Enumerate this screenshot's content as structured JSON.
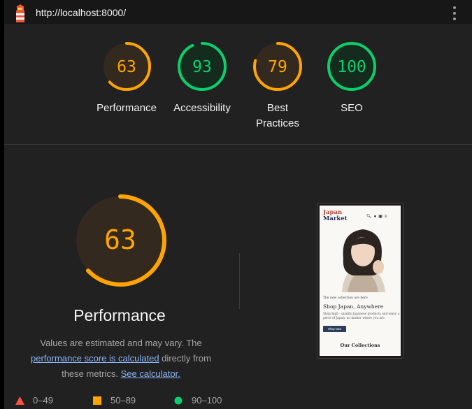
{
  "topbar": {
    "url": "http://localhost:8000/"
  },
  "colors": {
    "orange": "#ffa400",
    "green": "#0cce6b",
    "red": "#ff4e42",
    "bg": "#212121"
  },
  "categories": [
    {
      "label": "Performance",
      "score": 63,
      "status": "average"
    },
    {
      "label": "Accessibility",
      "score": 93,
      "status": "pass"
    },
    {
      "label": "Best Practices",
      "score": 79,
      "status": "average"
    },
    {
      "label": "SEO",
      "score": 100,
      "status": "pass"
    }
  ],
  "main": {
    "score": 63,
    "title": "Performance",
    "description_pre": "Values are estimated and may vary. The",
    "link1": "performance score is calculated",
    "description_mid": "directly from these metrics.",
    "link2": "See calculator."
  },
  "legend": [
    {
      "range": "0–49",
      "shape": "triangle"
    },
    {
      "range": "50–89",
      "shape": "square"
    },
    {
      "range": "90–100",
      "shape": "circle"
    }
  ],
  "screenshot": {
    "brand_line1": "Japan",
    "brand_line2": "Market",
    "kicker": "The new collection are here",
    "heading": "Shop Japan, Anywhere",
    "body": "Shop high - quality Japanese products and enjoy a piece of Japan, no matter where you are.",
    "button": "Shop Now",
    "collections": "Our Collections"
  }
}
